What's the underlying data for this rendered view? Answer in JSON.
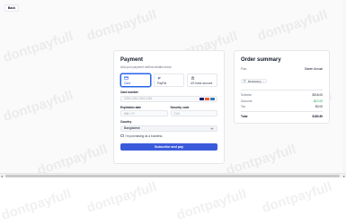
{
  "header": {
    "back_label": "Back"
  },
  "payment": {
    "title": "Payment",
    "subtitle": "Add your payment method details below",
    "methods": [
      {
        "label": "Card",
        "icon": "card-icon",
        "selected": true
      },
      {
        "label": "PayPal",
        "icon": "paypal-icon",
        "selected": false
      },
      {
        "label": "US bank account",
        "icon": "bank-icon",
        "selected": false
      }
    ],
    "card_number_label": "Card number",
    "card_number_placeholder": "1234 1234 1234 1234",
    "expiration_label": "Expiration date",
    "expiration_placeholder": "MM / YY",
    "security_label": "Security code",
    "security_placeholder": "CVC",
    "country_label": "Country",
    "country_value": "Bangladesh",
    "business_label": "I'm purchasing as a business",
    "submit_label": "Subscribe and pay",
    "accent": "#3b5bdb"
  },
  "summary": {
    "title": "Order summary",
    "plan_label": "Plan",
    "plan_value": "Starter Annual",
    "promo_code": "BFM2HNQ",
    "rows": [
      {
        "label": "Subtotal",
        "value": "$216.00"
      },
      {
        "label": "Discount",
        "value": "-$12.00"
      },
      {
        "label": "Tax",
        "value": "$0.00"
      }
    ],
    "total_label": "Total",
    "total_value": "$180.80"
  },
  "watermark": "dontpayfull"
}
